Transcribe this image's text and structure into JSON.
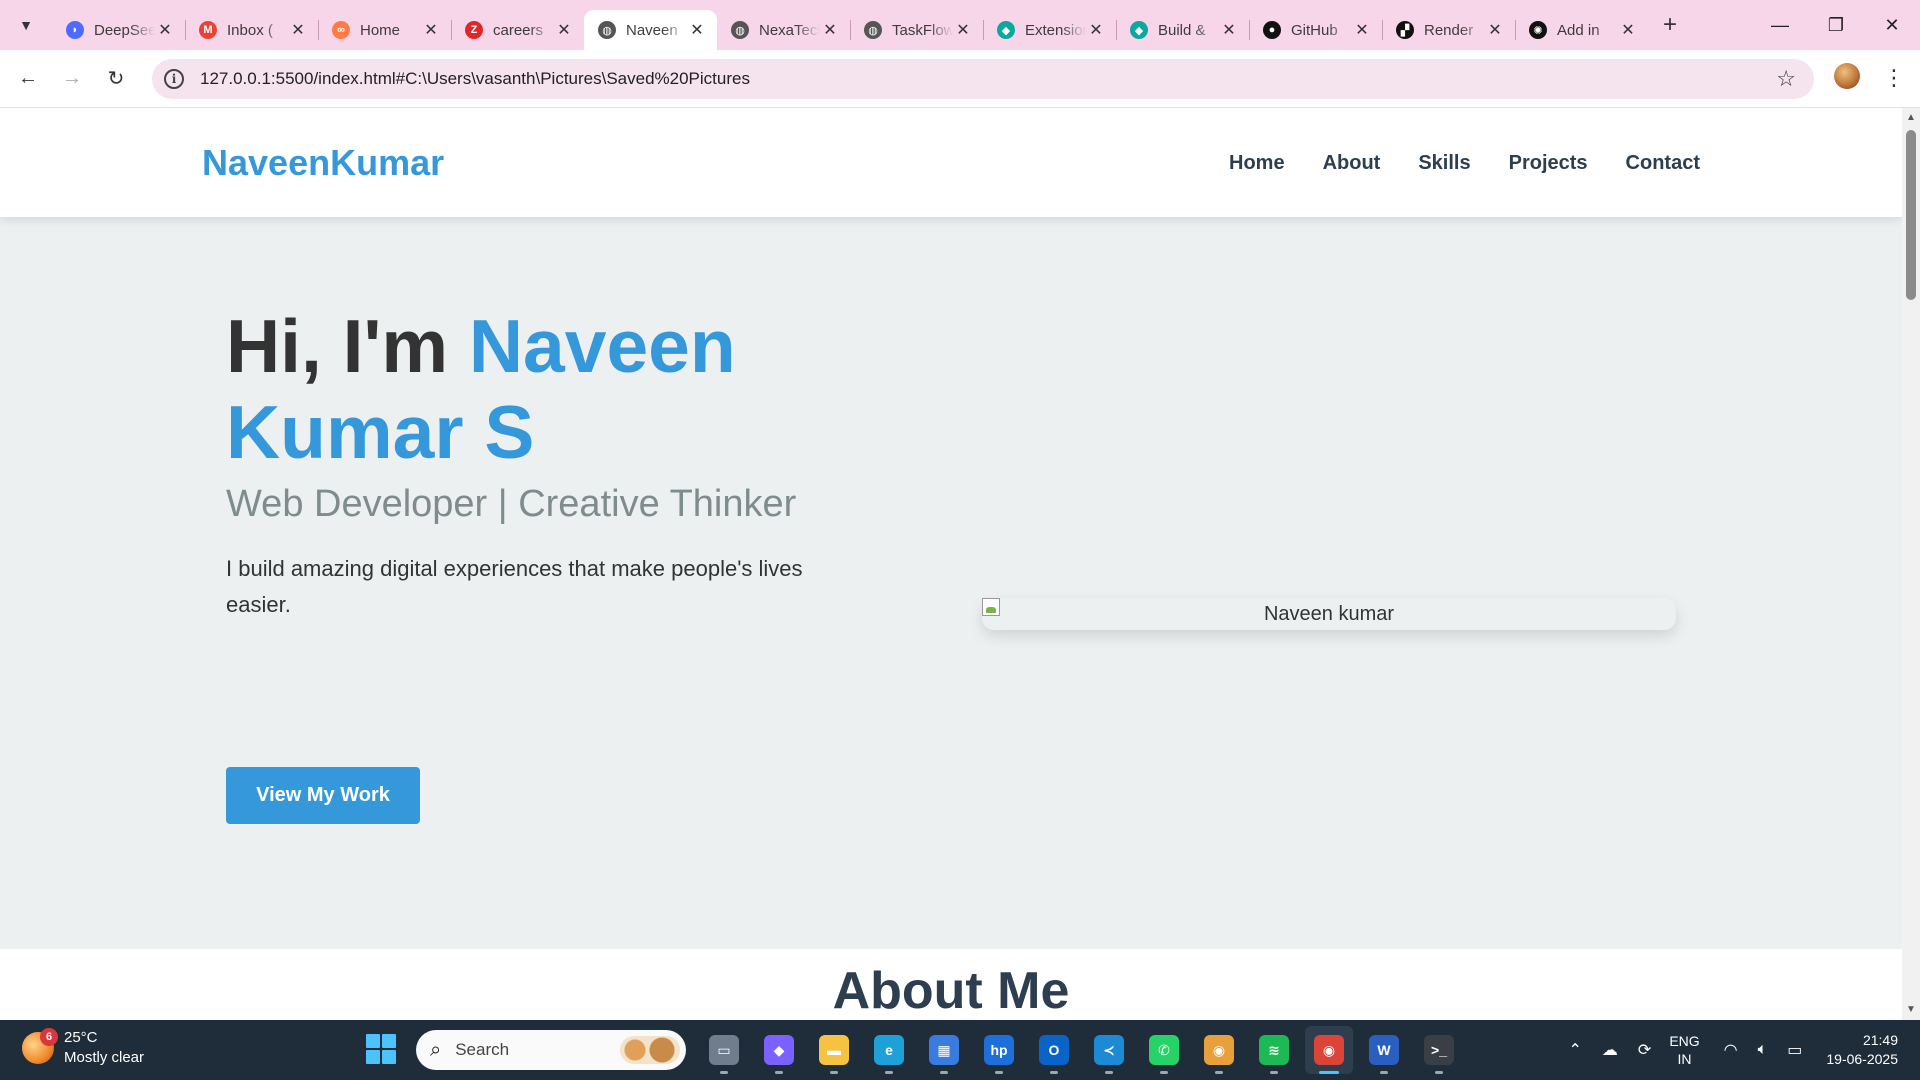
{
  "browser": {
    "tabs": [
      {
        "title": "DeepSeek",
        "icon": "deepseek-icon",
        "color": "#4d6bfe"
      },
      {
        "title": "Inbox (",
        "icon": "gmail-icon",
        "color": "#ea4335"
      },
      {
        "title": "Home",
        "icon": "link-icon",
        "color": "#ff7a45"
      },
      {
        "title": "careers",
        "icon": "zoho-icon",
        "color": "#e42527"
      },
      {
        "title": "Naveen",
        "icon": "globe-icon",
        "color": "#555555",
        "active": true
      },
      {
        "title": "NexaTech",
        "icon": "globe-icon",
        "color": "#555555"
      },
      {
        "title": "TaskFlow",
        "icon": "globe-icon",
        "color": "#555555"
      },
      {
        "title": "Extensions",
        "icon": "diamond-icon",
        "color": "#0aa89e"
      },
      {
        "title": "Build &",
        "icon": "diamond-icon",
        "color": "#0aa89e"
      },
      {
        "title": "GitHub",
        "icon": "github-icon",
        "color": "#111111"
      },
      {
        "title": "Render",
        "icon": "render-icon",
        "color": "#111111"
      },
      {
        "title": "Add in",
        "icon": "openai-icon",
        "color": "#111111"
      }
    ],
    "url": "127.0.0.1:5500/index.html#C:\\Users\\vasanth\\Pictures\\Saved%20Pictures"
  },
  "site": {
    "logo": "NaveenKumar",
    "nav": [
      "Home",
      "About",
      "Skills",
      "Projects",
      "Contact"
    ],
    "hero": {
      "greeting": "Hi, I'm ",
      "name": "Naveen Kumar S",
      "subtitle": "Web Developer | Creative Thinker",
      "description": "I build amazing digital experiences that make people's lives easier.",
      "cta": "View My Work",
      "image_alt": "Naveen kumar"
    },
    "about_title": "About Me",
    "colors": {
      "accent": "#3498db",
      "heading": "#2c3e50",
      "hero_bg": "#ecf0f1"
    }
  },
  "taskbar": {
    "weather": {
      "temp": "25°C",
      "condition": "Mostly clear",
      "badge": "6"
    },
    "search_label": "Search",
    "apps": [
      {
        "name": "task-view-icon",
        "color": "#6f7d8c",
        "glyph": "▭"
      },
      {
        "name": "copilot-icon",
        "color": "#7b61ff",
        "glyph": "◆"
      },
      {
        "name": "file-explorer-icon",
        "color": "#f5c242",
        "glyph": "▬"
      },
      {
        "name": "edge-icon",
        "color": "#1fa0d8",
        "glyph": "e"
      },
      {
        "name": "store-icon",
        "color": "#3a7be0",
        "glyph": "▦"
      },
      {
        "name": "myhp-icon",
        "color": "#1e6fd9",
        "glyph": "hp"
      },
      {
        "name": "outlook-icon",
        "color": "#0a64c8",
        "glyph": "O"
      },
      {
        "name": "vscode-icon",
        "color": "#1e8ad6",
        "glyph": "≺"
      },
      {
        "name": "whatsapp-icon",
        "color": "#25d366",
        "glyph": "✆"
      },
      {
        "name": "chrome-profile-icon",
        "color": "#e8a13a",
        "glyph": "◉"
      },
      {
        "name": "spotify-icon",
        "color": "#1db954",
        "glyph": "≋"
      },
      {
        "name": "chrome-icon",
        "color": "#db4437",
        "glyph": "◉",
        "active": true
      },
      {
        "name": "word-icon",
        "color": "#2b5fbf",
        "glyph": "W"
      },
      {
        "name": "terminal-icon",
        "color": "#3a3f47",
        "glyph": ">_"
      }
    ],
    "lang": [
      "ENG",
      "IN"
    ],
    "time": "21:49",
    "date": "19-06-2025"
  }
}
